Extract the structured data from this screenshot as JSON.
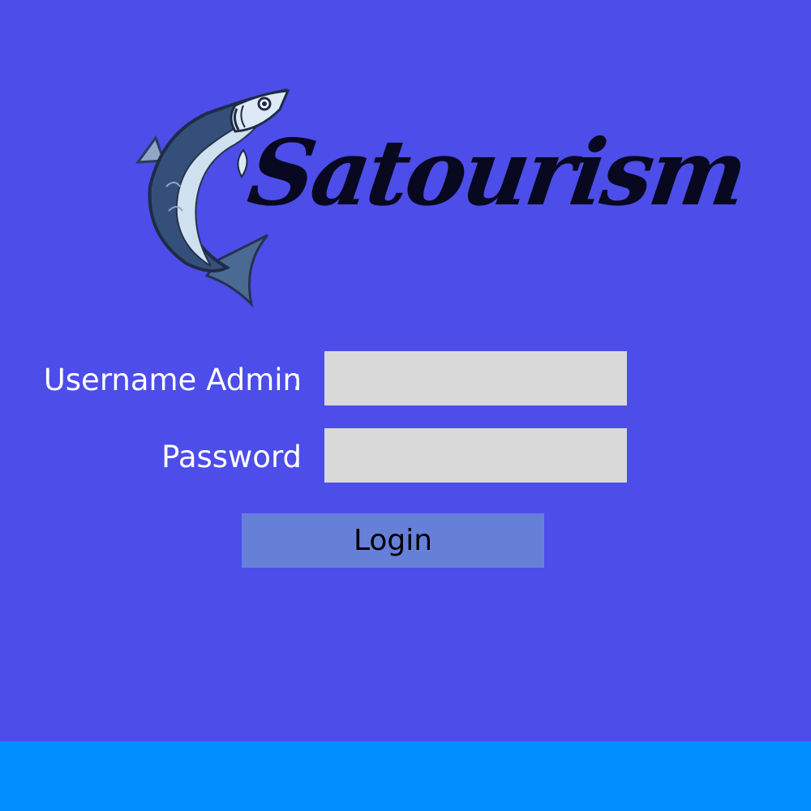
{
  "colors": {
    "background": "#4d4de9",
    "input_background": "#d9d9d9",
    "button_background": "#6680d8",
    "footer": "#008ffd"
  },
  "logo": {
    "text": "Satourism",
    "icon": "fish-icon"
  },
  "form": {
    "username_label": "Username Admin",
    "username_colon": ":",
    "username_value": "",
    "password_label": "Password",
    "password_colon": ":",
    "password_value": "",
    "login_label": "Login"
  }
}
